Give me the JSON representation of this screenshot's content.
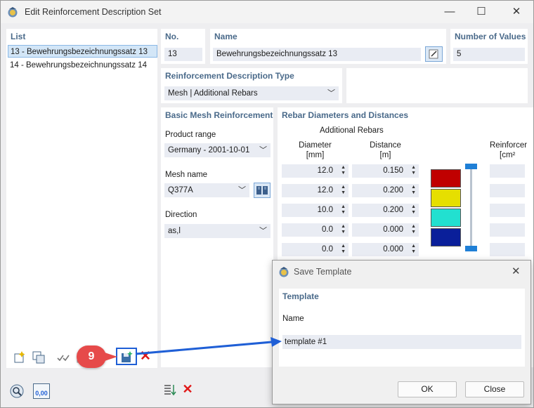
{
  "window": {
    "title": "Edit Reinforcement Description Set",
    "min_glyph": "—",
    "max_glyph": "☐",
    "close_glyph": "✕"
  },
  "list": {
    "title": "List",
    "items": [
      {
        "label": "13 - Bewehrungsbezeichnungssatz 13",
        "selected": true
      },
      {
        "label": "14 - Bewehrungsbezeichnungssatz 14",
        "selected": false
      }
    ]
  },
  "no": {
    "title": "No.",
    "value": "13"
  },
  "name": {
    "title": "Name",
    "value": "Bewehrungsbezeichnungssatz 13"
  },
  "number_of_values": {
    "title": "Number of Values",
    "value": "5"
  },
  "description_type": {
    "title": "Reinforcement Description Type",
    "value": "Mesh | Additional Rebars"
  },
  "basic_mesh": {
    "title": "Basic Mesh Reinforcement",
    "product_range_label": "Product range",
    "product_range_value": "Germany - 2001-10-01",
    "mesh_name_label": "Mesh name",
    "mesh_name_value": "Q377A",
    "direction_label": "Direction",
    "direction_value": "as,l"
  },
  "rebar": {
    "title": "Rebar Diameters and Distances",
    "subheader": "Additional Rebars",
    "diameter_header": "Diameter",
    "diameter_unit": "[mm]",
    "distance_header": "Distance",
    "distance_unit": "[m]",
    "reinf_header": "Reinforcer",
    "reinf_unit": "[cm²",
    "rows": [
      {
        "diameter": "12.0",
        "distance": "0.150",
        "color": "#c00000"
      },
      {
        "diameter": "12.0",
        "distance": "0.200",
        "color": "#e6df00"
      },
      {
        "diameter": "10.0",
        "distance": "0.200",
        "color": "#22e0d0"
      },
      {
        "diameter": "0.0",
        "distance": "0.000",
        "color": "#0a1f9a"
      },
      {
        "diameter": "0.0",
        "distance": "0.000"
      }
    ]
  },
  "callout": {
    "number": "9"
  },
  "save_template": {
    "title": "Save Template",
    "section_title": "Template",
    "name_label": "Name",
    "name_value": "template #1",
    "ok_label": "OK",
    "close_label": "Close",
    "close_glyph": "✕"
  },
  "bottom_value_icon_text": "0,00",
  "colors": {
    "accent_blue": "#1f5fd6",
    "callout_red": "#e64a4a",
    "header_text": "#4a6a8a",
    "field_bg": "#e9ecf3"
  }
}
